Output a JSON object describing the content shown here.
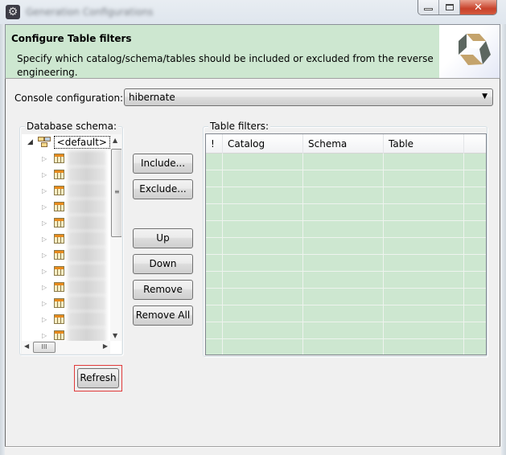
{
  "window": {
    "title": "Generation Configurations",
    "controls": {
      "minimize": "minimize",
      "maximize": "maximize",
      "close": "close"
    },
    "icon": "gear-icon"
  },
  "header": {
    "title": "Configure Table filters",
    "description": "Specify which catalog/schema/tables should be included or excluded from the reverse engineering.",
    "logo": "hibernate-logo"
  },
  "console": {
    "label": "Console configuration:",
    "value": "hibernate"
  },
  "schema": {
    "label": "Database schema:",
    "root": "<default>",
    "table_count_visible": 12
  },
  "buttons": {
    "include": "Include...",
    "exclude": "Exclude...",
    "up": "Up",
    "down": "Down",
    "remove": "Remove",
    "remove_all": "Remove All",
    "refresh": "Refresh"
  },
  "filters": {
    "label": "Table filters:",
    "columns": [
      "!",
      "Catalog",
      "Schema",
      "Table",
      ""
    ],
    "rows": []
  }
}
